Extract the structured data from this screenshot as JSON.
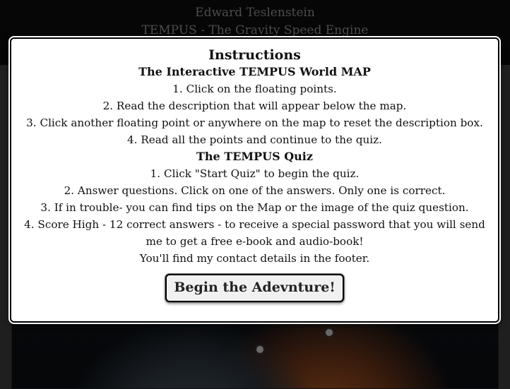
{
  "header": {
    "author": "Edward Teslenstein",
    "subtitle": "TEMPUS - The Gravity Speed Engine"
  },
  "modal": {
    "title": "Instructions",
    "map_section": {
      "heading": "The Interactive TEMPUS World MAP",
      "steps": [
        "1. Click on the floating points.",
        "2. Read the description that will appear below the map.",
        "3. Click another floating point or anywhere on the map to reset the description box.",
        "4. Read all the points and continue to the quiz."
      ]
    },
    "quiz_section": {
      "heading": "The TEMPUS Quiz",
      "steps": [
        "1. Click \"Start Quiz\" to begin the quiz.",
        "2. Answer questions. Click on one of the answers. Only one is correct.",
        "3. If in trouble- you can find tips on the Map or the image of the quiz question.",
        "4. Score High - 12 correct answers - to receive a special password that you will send me to get a free e-book and audio-book!",
        "You'll find my contact details in the footer."
      ]
    },
    "begin_button": "Begin the Adevnture!"
  },
  "colors": {
    "header_bg": "#0c0c0c",
    "modal_bg": "#ffffff",
    "overlay": "rgba(0,0,0,0.45)"
  },
  "icons": [
    "map-point-icon"
  ]
}
